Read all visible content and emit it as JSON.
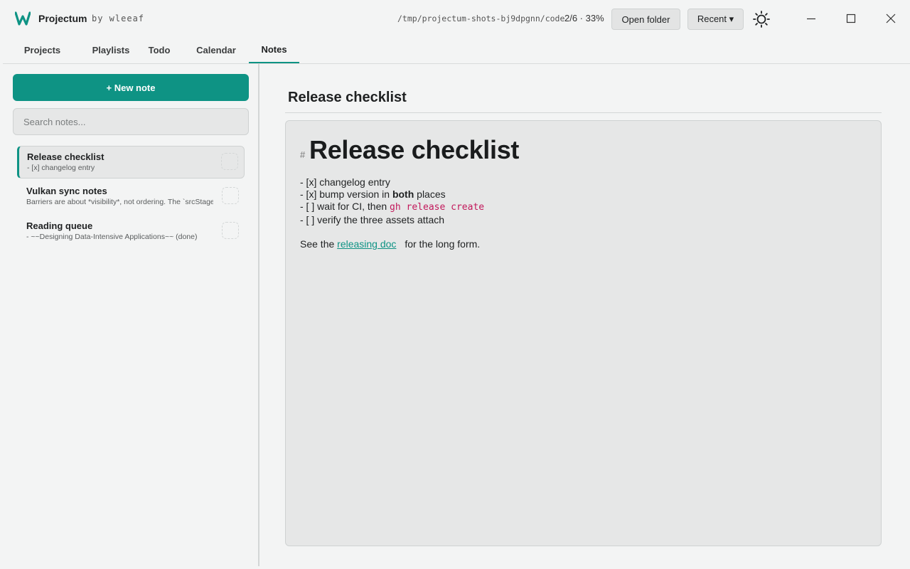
{
  "titlebar": {
    "app_name": "Projectum",
    "by_text": "by wleeaf",
    "path": "/tmp/projectum-shots-bj9dpgnn/code",
    "progress": "2/6 · 33%",
    "open_folder_label": "Open folder",
    "recent_label": "Recent ▾",
    "brand_color": "#0e9384"
  },
  "tabs": [
    {
      "label": "Projects"
    },
    {
      "label": "Playlists"
    },
    {
      "label": "Todo"
    },
    {
      "label": "Calendar"
    },
    {
      "label": "Notes",
      "active": true
    }
  ],
  "sidebar": {
    "new_note_label": "+ New note",
    "search_placeholder": "Search notes...",
    "notes": [
      {
        "title": "Release checklist",
        "preview": "- [x] changelog entry",
        "selected": true
      },
      {
        "title": "Vulkan sync notes",
        "preview": "Barriers are about *visibility*, not ordering. The `srcStageMask` field"
      },
      {
        "title": "Reading queue",
        "preview": "- ~~Designing Data-Intensive Applications~~ (done)"
      }
    ]
  },
  "main": {
    "title": "Release checklist",
    "editor": {
      "hash": "#",
      "heading": "Release checklist",
      "line1": "- [x] changelog entry",
      "line2_a": "- [x] bump version in ",
      "line2_b": "both",
      "line2_c": " places",
      "line3_a": "- [ ] wait for CI, then ",
      "line3_code": "gh release create",
      "line4": "- [ ] verify the three assets attach",
      "line5_a": "See the ",
      "line5_link": "releasing doc",
      "line5_b": " for the long form."
    }
  }
}
